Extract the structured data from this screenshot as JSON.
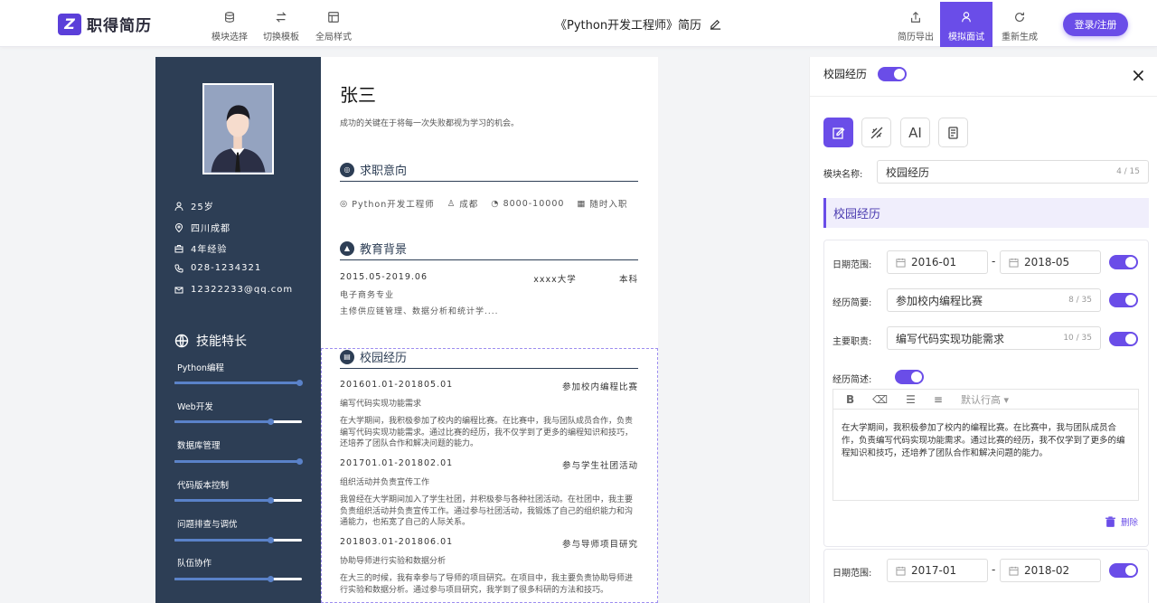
{
  "app": {
    "logo_text": "职得简历",
    "logo_mark": "Z"
  },
  "toolbar": {
    "left_tools": [
      {
        "label": "模块选择",
        "icon": "stack-icon"
      },
      {
        "label": "切换模板",
        "icon": "swap-icon"
      },
      {
        "label": "全局样式",
        "icon": "layout-icon"
      }
    ],
    "doc_title": "《Python开发工程师》简历",
    "right_tools": [
      {
        "label": "简历导出",
        "icon": "export-icon"
      },
      {
        "label": "模拟面试",
        "icon": "interview-icon"
      },
      {
        "label": "重新生成",
        "icon": "refresh-icon"
      }
    ],
    "login_label": "登录/注册",
    "accent": "#6a4de8"
  },
  "resume": {
    "name": "张三",
    "motto": "成功的关键在于将每一次失败都视为学习的机会。",
    "info": [
      "25岁",
      "四川成都",
      "4年经验",
      "028-1234321",
      "12322233@qq.com"
    ],
    "skills_title": "技能特长",
    "skills": [
      {
        "name": "Python编程",
        "level": 1.0
      },
      {
        "name": "Web开发",
        "level": 0.77
      },
      {
        "name": "数据库管理",
        "level": 1.0
      },
      {
        "name": "代码版本控制",
        "level": 0.77
      },
      {
        "name": "问题排查与调优",
        "level": 0.77
      },
      {
        "name": "队伍协作",
        "level": 0.77
      }
    ],
    "intent_title": "求职意向",
    "intent": [
      "Python开发工程师",
      "成都",
      "8000-10000",
      "随时入职"
    ],
    "edu_title": "教育背景",
    "edu": {
      "period": "2015.05-2019.06",
      "school": "xxxx大学",
      "degree": "本科",
      "major": "电子商务专业",
      "desc": "主修供应链管理、数据分析和统计学...."
    },
    "exp_title": "校园经历",
    "experiences": [
      {
        "period": "201601.01-201805.01",
        "title": "参加校内编程比赛",
        "role": "编写代码实现功能需求",
        "desc": "在大学期间，我积极参加了校内的编程比赛。在比赛中，我与团队成员合作，负责编写代码实现功能需求。通过比赛的经历，我不仅学到了更多的编程知识和技巧，还培养了团队合作和解决问题的能力。"
      },
      {
        "period": "201701.01-201802.01",
        "title": "参与学生社团活动",
        "role": "组织活动并负责宣传工作",
        "desc": "我曾经在大学期间加入了学生社团，并积极参与各种社团活动。在社团中，我主要负责组织活动并负责宣传工作。通过参与社团活动，我锻炼了自己的组织能力和沟通能力，也拓宽了自己的人际关系。"
      },
      {
        "period": "201803.01-201806.01",
        "title": "参与导师项目研究",
        "role": "协助导师进行实验和数据分析",
        "desc": "在大三的时候，我有幸参与了导师的项目研究。在项目中，我主要负责协助导师进行实验和数据分析。通过参与项目研究，我学到了很多科研的方法和技巧。"
      }
    ]
  },
  "panel": {
    "title": "校园经历",
    "close": "×",
    "modes": [
      "edit-icon",
      "style-icon",
      "AI",
      "note-icon"
    ],
    "module_label": "模块名称:",
    "module_value": "校园经历",
    "module_count": "4 / 15",
    "band_title": "校园经历",
    "date_label": "日期范围:",
    "date_sep": "-",
    "summary_label": "经历简要:",
    "duty_label": "主要职责:",
    "desc_label": "经历简述:",
    "editor_placeholder": "默认行高",
    "delete_label": "删除",
    "entries": [
      {
        "start": "2016-01",
        "end": "2018-05",
        "summary": "参加校内编程比赛",
        "summary_count": "8 / 35",
        "duty": "编写代码实现功能需求",
        "duty_count": "10 / 35",
        "desc": "在大学期间，我积极参加了校内的编程比赛。在比赛中，我与团队成员合作，负责编写代码实现功能需求。通过比赛的经历，我不仅学到了更多的编程知识和技巧，还培养了团队合作和解决问题的能力。"
      },
      {
        "start": "2017-01",
        "end": "2018-02"
      }
    ]
  }
}
